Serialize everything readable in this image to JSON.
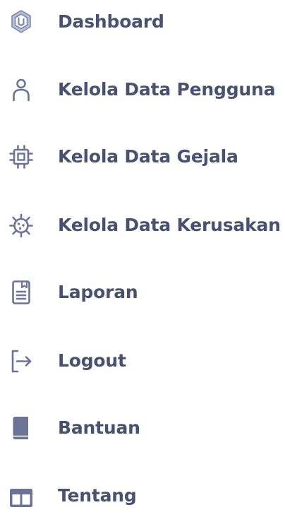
{
  "colors": {
    "text": "#4a5170",
    "icon": "#6b7497"
  },
  "sidebar": {
    "items": [
      {
        "label": "Dashboard",
        "icon": "layers-logo-icon"
      },
      {
        "label": "Kelola Data Pengguna",
        "icon": "user-icon"
      },
      {
        "label": "Kelola Data Gejala",
        "icon": "chip-icon"
      },
      {
        "label": "Kelola Data Kerusakan",
        "icon": "virus-icon"
      },
      {
        "label": "Laporan",
        "icon": "report-icon"
      },
      {
        "label": "Logout",
        "icon": "logout-icon"
      },
      {
        "label": "Bantuan",
        "icon": "book-icon"
      },
      {
        "label": "Tentang",
        "icon": "layout-icon"
      }
    ]
  }
}
